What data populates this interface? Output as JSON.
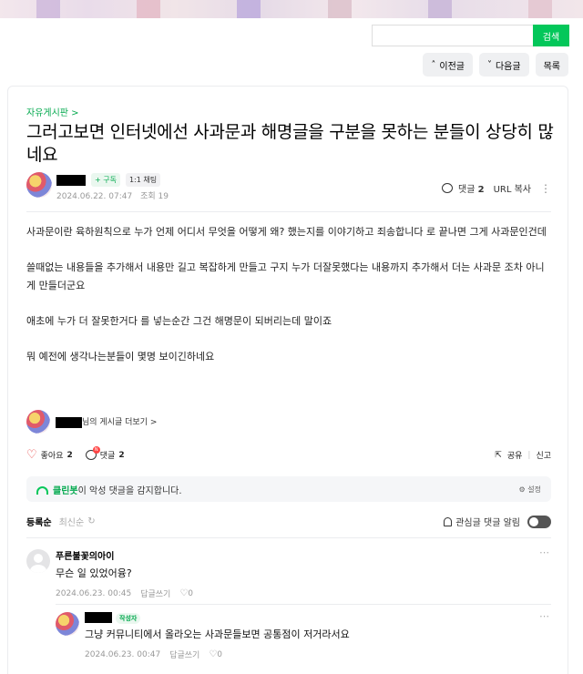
{
  "search": {
    "button_label": "검색",
    "placeholder": ""
  },
  "nav": {
    "prev_label": "이전글",
    "next_label": "다음글",
    "list_label": "목록"
  },
  "post": {
    "board": "자유게시판 >",
    "title": "그러고보면 인터넷에선 사과문과 해명글을 구분을 못하는 분들이 상당히 많네요",
    "subscribe_label": "+ 구독",
    "chat_label": "1:1 채팅",
    "date": "2024.06.22. 07:47",
    "views": "조회 19",
    "comment_label": "댓글",
    "comment_count": "2",
    "copy_url_label": "URL 복사",
    "paragraphs": [
      "사과문이란 육하원칙으로 누가 언제 어디서 무엇을 어떻게 왜? 했는지를 이야기하고 죄송합니다 로 끝나면 그게 사과문인건데",
      "쓸때없는 내용들을 추가해서 내용만 길고 복잡하게 만들고 구지 누가 더잘못했다는 내용까지 추가해서 더는 사과문 조차 아니게 만들더군요",
      "애초에 누가 더 잘못한거다 를 넣는순간 그건 해명문이 되버리는데 말이죠",
      "뭐 예전에 생각나는분들이 몇명 보이긴하네요"
    ],
    "author_more": "님의 게시글 더보기 >"
  },
  "actions": {
    "like_label": "좋아요",
    "like_count": "2",
    "comment_label": "댓글",
    "comment_count": "2",
    "share_label": "공유",
    "report_label": "신고",
    "heart_color": "#e84545"
  },
  "cleanbot": {
    "name": "클린봇",
    "text": "이 악성 댓글을 감지합니다.",
    "setting_label": "설정"
  },
  "comments_section": {
    "sort_registered": "등록순",
    "sort_latest": "최신순",
    "notify_label": "관심글 댓글 알림"
  },
  "comments": [
    {
      "author": "푸른불꽃의아이",
      "text": "무슨 일 있었어융?",
      "date": "2024.06.23. 00:45",
      "reply_label": "답글쓰기",
      "likes": "0"
    },
    {
      "author_badge": "작성자",
      "text": "그냥 커뮤니티에서 올라오는 사과문들보면 공통점이 저거라서요",
      "date": "2024.06.23. 00:47",
      "reply_label": "답글쓰기",
      "likes": "0"
    }
  ],
  "colors": {
    "accent": "#03c75a",
    "accent_text": "#03a94e"
  }
}
